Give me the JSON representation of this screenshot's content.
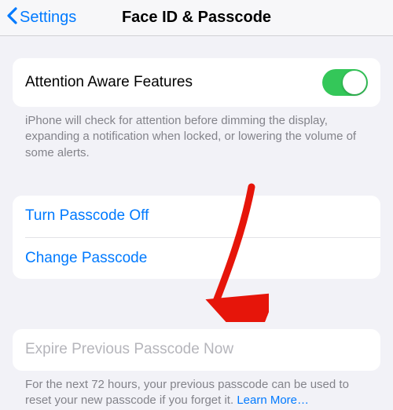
{
  "nav": {
    "back_label": "Settings",
    "title": "Face ID & Passcode"
  },
  "attention": {
    "label": "Attention Aware Features",
    "toggle_on": true,
    "footer": "iPhone will check for attention before dimming the display, expanding a notification when locked, or lowering the volume of some alerts."
  },
  "passcode": {
    "turn_off": "Turn Passcode Off",
    "change": "Change Passcode"
  },
  "expire": {
    "label": "Expire Previous Passcode Now",
    "footer_prefix": "For the next 72 hours, your previous passcode can be used to reset your new passcode if you forget it. ",
    "learn_more": "Learn More…"
  }
}
